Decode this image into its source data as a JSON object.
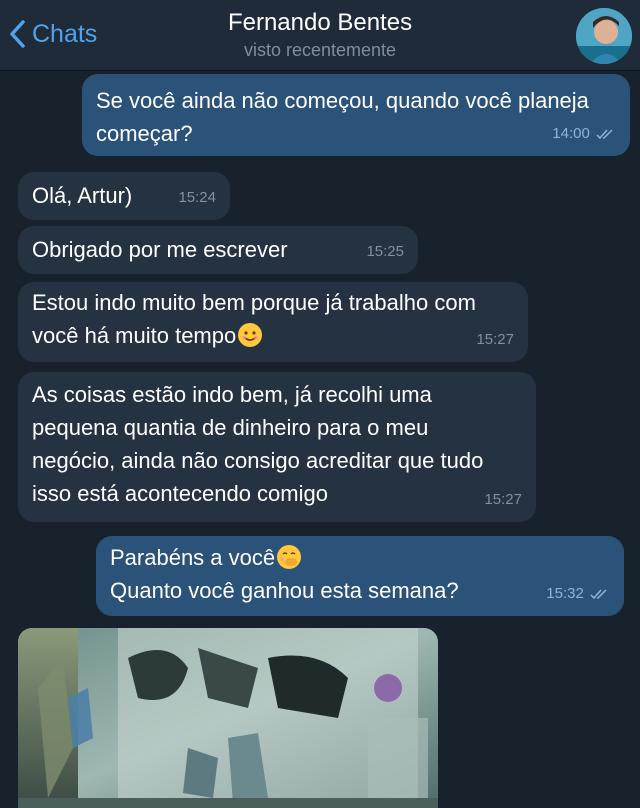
{
  "header": {
    "back_label": "Chats",
    "contact_name": "Fernando Bentes",
    "status": "visto recentemente"
  },
  "messages": [
    {
      "direction": "out",
      "text": "Se você ainda não começou, quando você planeja começar?",
      "time": "14:00",
      "read": true
    },
    {
      "direction": "in",
      "text": "Olá, Artur)",
      "time": "15:24"
    },
    {
      "direction": "in",
      "text": "Obrigado por me escrever",
      "time": "15:25"
    },
    {
      "direction": "in",
      "text": "Estou indo muito bem porque já trabalho com você há muito tempo",
      "emoji": "smiling-face",
      "time": "15:27"
    },
    {
      "direction": "in",
      "text": "As coisas estão indo bem, já recolhi uma pequena quantia de dinheiro para o meu negócio, ainda não consigo acreditar que tudo isso está acontecendo comigo",
      "time": "15:27"
    },
    {
      "direction": "out",
      "text": "Parabéns a você",
      "emoji": "face-with-hand-over-mouth",
      "text2": "Quanto você ganhou esta semana?",
      "time": "15:32",
      "read": true
    },
    {
      "direction": "in",
      "type": "photo",
      "description_icon": "banknotes-photo"
    }
  ],
  "colors": {
    "background": "#18222d",
    "header": "#1f2b38",
    "incoming_bubble": "#243241",
    "outgoing_bubble": "#2b5278",
    "accent": "#4ea3ec"
  }
}
